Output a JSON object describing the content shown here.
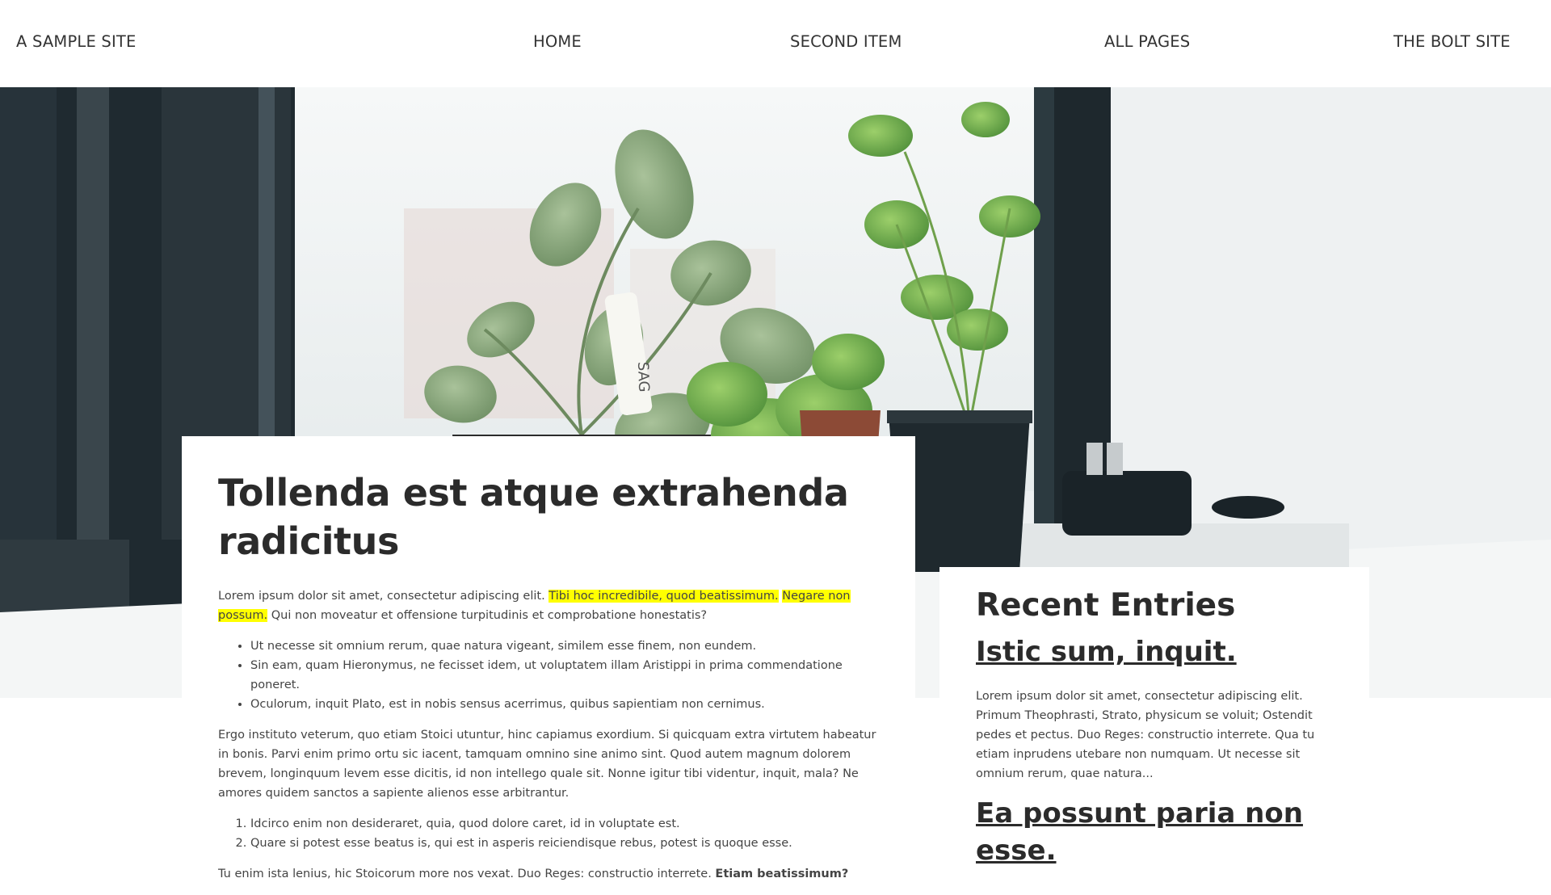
{
  "nav": {
    "brand": "A SAMPLE SITE",
    "items": [
      "HOME",
      "SECOND ITEM",
      "ALL PAGES",
      "THE BOLT SITE"
    ]
  },
  "hero": {
    "image": "plants-on-windowsill",
    "plant_tag_text": "SAG"
  },
  "article": {
    "title": "Tollenda est atque extrahenda radicitus",
    "intro_plain": "Lorem ipsum dolor sit amet, consectetur adipiscing elit. ",
    "intro_highlight_1": "Tibi hoc incredibile, quod beatissimum.",
    "intro_highlight_2": "Negare non possum.",
    "intro_rest": " Qui non moveatur et offensione turpitudinis et comprobatione honestatis?",
    "bullets": [
      "Ut necesse sit omnium rerum, quae natura vigeant, similem esse finem, non eundem.",
      "Sin eam, quam Hieronymus, ne fecisset idem, ut voluptatem illam Aristippi in prima commendatione poneret.",
      "Oculorum, inquit Plato, est in nobis sensus acerrimus, quibus sapientiam non cernimus."
    ],
    "paragraph2": "Ergo instituto veterum, quo etiam Stoici utuntur, hinc capiamus exordium. Si quicquam extra virtutem habeatur in bonis. Parvi enim primo ortu sic iacent, tamquam omnino sine animo sint. Quod autem magnum dolorem brevem, longinquum levem esse dicitis, id non intellego quale sit. Nonne igitur tibi videntur, inquit, mala? Ne amores quidem sanctos a sapiente alienos esse arbitrantur.",
    "numbered": [
      "Idcirco enim non desideraret, quia, quod dolore caret, id in voluptate est.",
      "Quare si potest esse beatus is, qui est in asperis reiciendisque rebus, potest is quoque esse."
    ],
    "last_plain": "Tu enim ista lenius, hic Stoicorum more nos vexat. Duo Reges: constructio interrete. ",
    "last_bold": "Etiam beatissimum?"
  },
  "sidebar": {
    "heading": "Recent Entries",
    "entries": [
      {
        "title": "Istic sum, inquit.",
        "excerpt": "Lorem ipsum dolor sit amet, consectetur adipiscing elit. Primum Theophrasti, Strato, physicum se voluit; Ostendit pedes et pectus. Duo Reges: constructio interrete. Qua tu etiam inprudens utebare non numquam. Ut necesse sit omnium rerum, quae natura..."
      },
      {
        "title": "Ea possunt paria non esse."
      }
    ]
  }
}
